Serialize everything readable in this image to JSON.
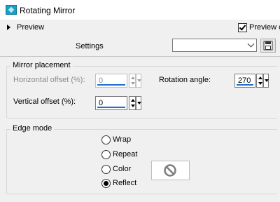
{
  "window": {
    "title": "Rotating Mirror",
    "app_icon": "app-icon"
  },
  "preview": {
    "label": "Preview",
    "checkbox_label": "Preview c",
    "checkbox_checked": true
  },
  "settings": {
    "label": "Settings",
    "selected_value": "",
    "save_icon": "save-icon"
  },
  "mirror_placement": {
    "title": "Mirror placement",
    "horizontal_offset": {
      "label": "Horizontal offset (%):",
      "value": "0",
      "disabled": true
    },
    "vertical_offset": {
      "label": "Vertical offset (%):",
      "value": "0",
      "disabled": false
    },
    "rotation_angle": {
      "label": "Rotation angle:",
      "value": "270",
      "disabled": false
    }
  },
  "edge_mode": {
    "title": "Edge mode",
    "options": [
      {
        "label": "Wrap",
        "selected": false
      },
      {
        "label": "Repeat",
        "selected": false
      },
      {
        "label": "Color",
        "selected": false
      },
      {
        "label": "Reflect",
        "selected": true
      }
    ],
    "color_swatch_icon": "no-color-icon"
  },
  "colors": {
    "accent": "#1e6fd0",
    "app_icon": "#1aa0c4",
    "background": "#f0f0f0"
  }
}
